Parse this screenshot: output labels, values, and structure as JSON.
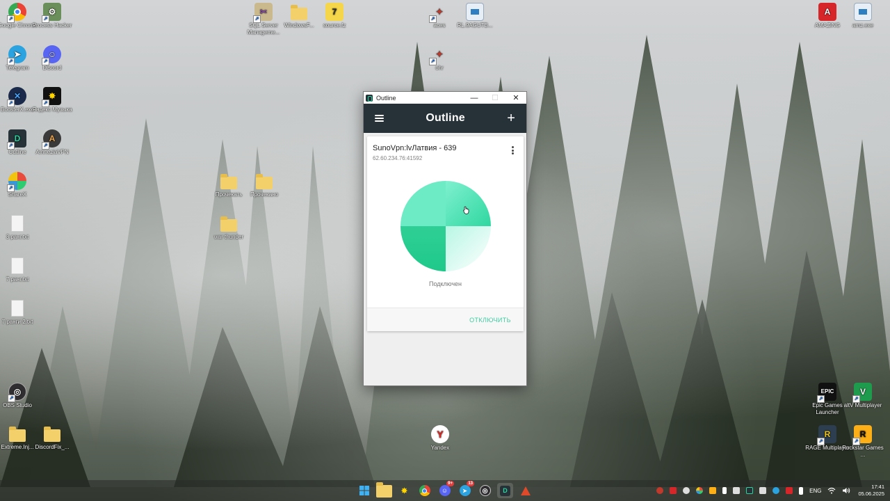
{
  "desktop": {
    "icons": {
      "chrome": "Google Chrome",
      "process_hacker": "Process Hacker",
      "telegram": "Telegram",
      "discord": "Discord",
      "booster": "BoosterX.exe",
      "yandex_music": "Яндекс Музыка",
      "outline": "Outline",
      "amnezia": "AmneziaVPN",
      "sharex": "ShareX",
      "file1": "3 ранг.txt",
      "file2": "7 ранг.txt",
      "file3": "7 ранги 2.txt",
      "obs": "OBS Studio",
      "folder_extreme": "Extreme.Inj...",
      "folder_discordfix": "DiscordFix_...",
      "sql": "SQL Server Manageme...",
      "windowsf": "WindowsF...",
      "sourcefz": "source.fz",
      "aces": "aces",
      "rl": "RL.9AGUTB...",
      "ohr": "ohr",
      "folder_read": "Прочекать",
      "folder_checked": "Прочекано",
      "folder_warthunder": "war thunder",
      "yandex": "Yandex",
      "amazing": "AMAZING",
      "amz": "amz.exe",
      "epic": "Epic Games Launcher",
      "altv": "altV Multiplayer",
      "rage": "RAGE Multiplayer",
      "rockstar": "Rockstar Games ..."
    }
  },
  "window": {
    "title": "Outline",
    "minimize": "—",
    "maximize": "☐",
    "close": "✕"
  },
  "app": {
    "header_title": "Outline",
    "add_label": "+",
    "server": {
      "name": "SunoVpn:lvЛатвия - 639",
      "address": "62.60.234.76:41592",
      "status": "Подключен",
      "disconnect_label": "ОТКЛЮЧИТЬ",
      "accent_color": "#3ccca0"
    }
  },
  "taskbar": {
    "badges": {
      "discord": "9+",
      "telegram": "13"
    },
    "language": "ENG",
    "time": "17:41",
    "date": "05.06.2025"
  }
}
